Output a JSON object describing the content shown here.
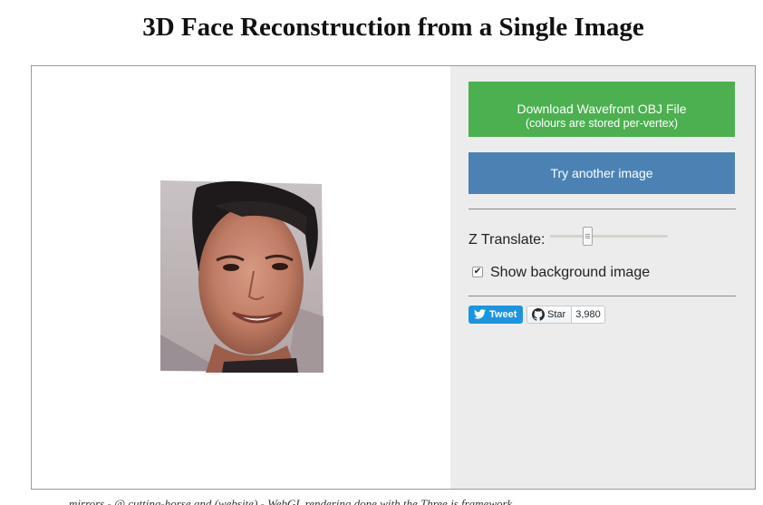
{
  "page": {
    "title": "3D Face Reconstruction from a Single Image"
  },
  "viewer": {
    "image_alt": "reconstructed-face"
  },
  "panel": {
    "download_label": "Download Wavefront OBJ File",
    "download_sublabel": "(colours are stored per-vertex)",
    "try_label": "Try another image",
    "z_translate_label": "Z Translate:",
    "z_translate_value": 0.3,
    "show_background_label": "Show background image",
    "show_background_checked": true,
    "check_glyph": "✔"
  },
  "social": {
    "tweet_label": "Tweet",
    "star_label": "Star",
    "star_count": "3,980"
  },
  "footer": {
    "text": "mirrors - @ cutting-horse and (website) - WebGL rendering done with the Three.js framework"
  },
  "colors": {
    "download": "#4cb050",
    "try": "#4b82b3",
    "panel_bg": "#ececec",
    "tweet": "#1b95e0"
  },
  "icons": [
    "twitter-bird-icon",
    "github-octocat-icon",
    "checkmark-icon",
    "slider-grip-icon"
  ]
}
